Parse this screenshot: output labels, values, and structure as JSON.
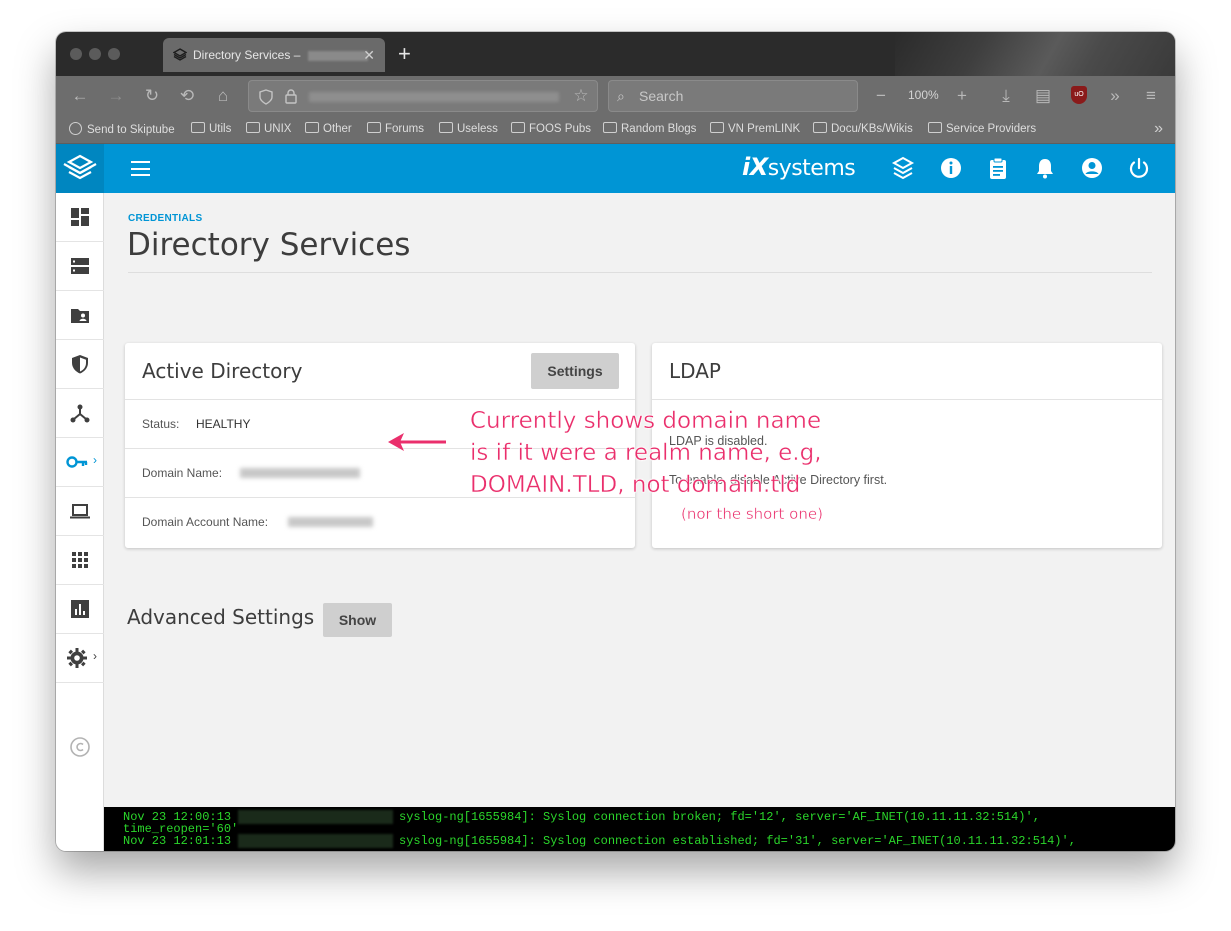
{
  "browser": {
    "tab_title": "Directory Services – ",
    "new_tab_symbol": "+",
    "search_placeholder": "Search",
    "zoom": "100%",
    "bookmarks": [
      {
        "label": "Send to Skiptube",
        "icon": "globe-icon"
      },
      {
        "label": "Utils",
        "icon": "folder-icon"
      },
      {
        "label": "UNIX",
        "icon": "folder-icon"
      },
      {
        "label": "Other",
        "icon": "folder-icon"
      },
      {
        "label": "Forums",
        "icon": "folder-icon"
      },
      {
        "label": "Useless",
        "icon": "folder-icon"
      },
      {
        "label": "FOOS Pubs",
        "icon": "folder-icon"
      },
      {
        "label": "Random Blogs",
        "icon": "folder-icon"
      },
      {
        "label": "VN PremLINK",
        "icon": "folder-icon"
      },
      {
        "label": "Docu/KBs/Wikis",
        "icon": "folder-icon"
      },
      {
        "label": "Service Providers",
        "icon": "folder-icon"
      }
    ]
  },
  "app": {
    "brand_prefix": "iX",
    "brand_suffix": "systems",
    "accent_color": "#0095d5",
    "breadcrumb": "CREDENTIALS",
    "page_title": "Directory Services"
  },
  "active_directory": {
    "title": "Active Directory",
    "settings_label": "Settings",
    "status_key": "Status:",
    "status_value": "HEALTHY",
    "domain_name_key": "Domain Name:",
    "domain_account_key": "Domain Account Name:"
  },
  "ldap": {
    "title": "LDAP",
    "line1": "LDAP is disabled.",
    "line2": "To enable, disable Active Directory first."
  },
  "advanced": {
    "title": "Advanced Settings",
    "show_label": "Show"
  },
  "console": {
    "lines": [
      {
        "time": "Nov 23 12:00:13",
        "msg": "syslog-ng[1655984]: Syslog connection broken; fd='12', server='AF_INET(10.11.11.32:514)',"
      },
      {
        "time": "time_reopen='60'",
        "msg": ""
      },
      {
        "time": "Nov 23 12:01:13",
        "msg": "syslog-ng[1655984]: Syslog connection established; fd='31', server='AF_INET(10.11.11.32:514)',"
      }
    ]
  },
  "annotation": {
    "line1": "Currently shows domain name",
    "line2": "is if it were a realm name, e.g,",
    "line3": "DOMAIN.TLD, not domain.tld",
    "note": "(nor the short one)",
    "color": "#ea2f6c"
  }
}
